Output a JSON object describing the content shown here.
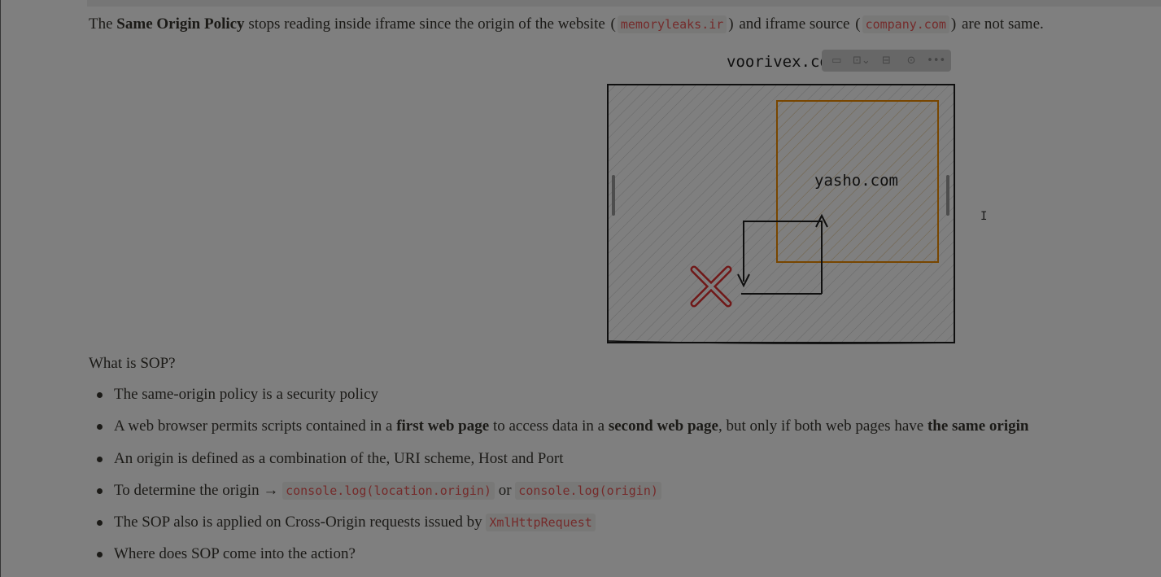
{
  "intro": {
    "t1": "The ",
    "b1": "Same Origin Policy",
    "t2": " stops reading inside iframe since the origin of the website ",
    "p_open1": "(",
    "code1": "memoryleaks.ir",
    "p_close1": ")",
    "t3": " and iframe source ",
    "p_open2": "(",
    "code2": "company.com",
    "p_close2": ")",
    "t4": " are not same."
  },
  "figure": {
    "outer_label": "voorivex.com",
    "inner_label": "yasho.com",
    "colors": {
      "outer_stroke": "#1e1e1e",
      "inner_stroke": "#f08c00",
      "cross": "#e03131",
      "hatch": "#bfbfbf",
      "inner_hatch": "#f5d9a8"
    }
  },
  "image_toolbar": {
    "buttons": [
      "comment-icon",
      "align-icon",
      "caption-icon",
      "download-icon",
      "more-icon"
    ],
    "glyphs": [
      "▭",
      "⊡⌄",
      "⊟",
      "⊙",
      "•••"
    ]
  },
  "cursor": {
    "glyph": "I"
  },
  "heading": "What is SOP?",
  "list": {
    "item1": "The same-origin policy is a security policy",
    "item2": {
      "a": "A web browser permits scripts contained in a ",
      "b1": "first web page",
      "c": " to access data in a ",
      "b2": "second web page",
      "d": ", but only if both web pages have ",
      "b3": "the same origin"
    },
    "item3": "An origin is defined as a combination of the, URI scheme, Host and Port",
    "item4": {
      "a": "To determine the origin → ",
      "code1": "console.log(location.origin)",
      "b": " or ",
      "code2": "console.log(origin)"
    },
    "item5": {
      "a": "The SOP also is applied on Cross-Origin requests issued by ",
      "code": "XmlHttpRequest"
    },
    "item6": "Where does SOP come into the action?"
  }
}
